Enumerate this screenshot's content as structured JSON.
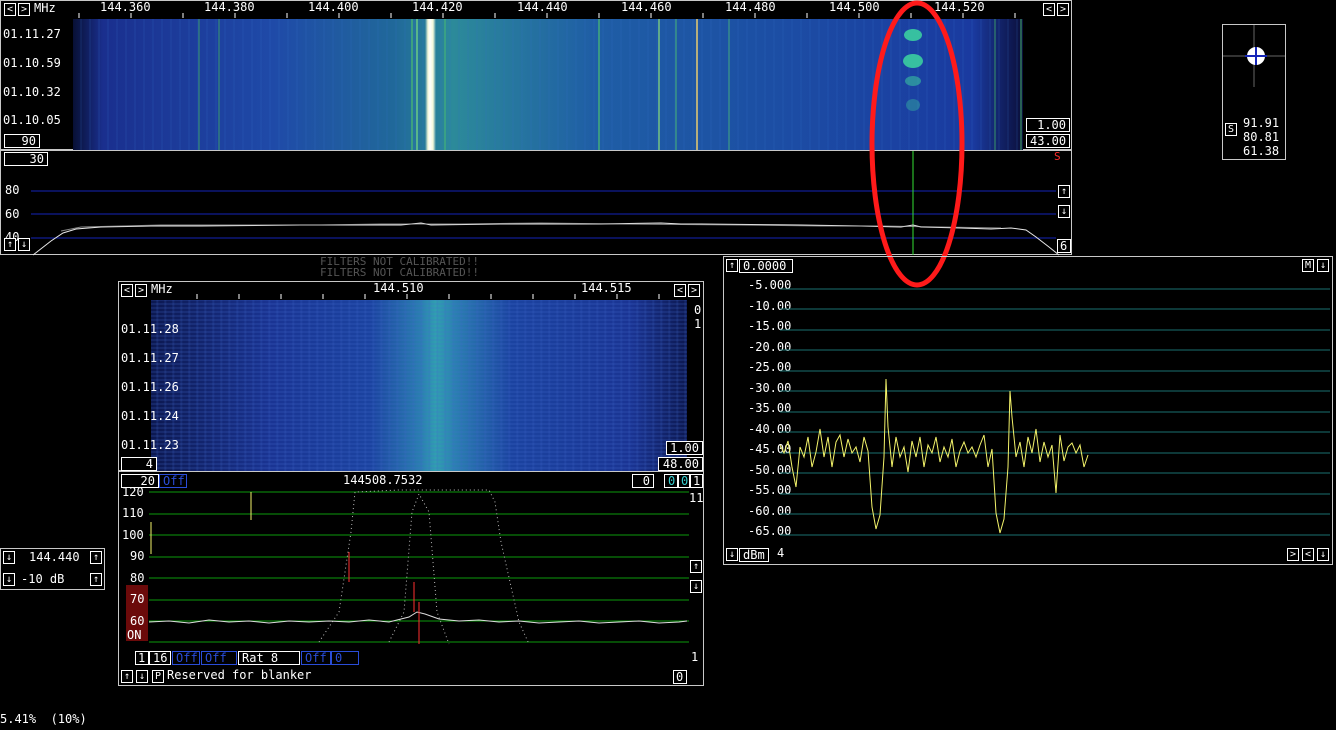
{
  "main_waterfall": {
    "unit": "MHz",
    "freq_ticks": [
      "144.360",
      "144.380",
      "144.400",
      "144.420",
      "144.440",
      "144.460",
      "144.480",
      "144.500",
      "144.520"
    ],
    "times": [
      "01.11.27",
      "01.10.59",
      "01.10.32",
      "01.10.05"
    ],
    "gain_box": "1.00",
    "zero_box": "43.00",
    "avg_box": "90"
  },
  "main_spectrum": {
    "range_box": "30",
    "s_label": "S",
    "y_ticks": [
      "80",
      "60",
      "40"
    ],
    "right_box": "6"
  },
  "warning": [
    "FILTERS NOT CALIBRATED!!",
    "FILTERS NOT CALIBRATED!!"
  ],
  "fft2": {
    "unit": "MHz",
    "freq_ticks": [
      "144.510",
      "144.515"
    ],
    "times": [
      "01.11.28",
      "01.11.27",
      "01.11.26",
      "01.11.24",
      "01.11.23"
    ],
    "right_top": [
      "0",
      "1"
    ],
    "gain_box": "1.00",
    "zero_box": "48.00",
    "avg_box": "4"
  },
  "baseband": {
    "range_box": "20",
    "off_label": "Off",
    "frequency": "144508.7532",
    "box_a": "0",
    "box_b": "0",
    "box_c": "0",
    "box_d": "1",
    "right_label": "11",
    "y_ticks": [
      "120",
      "110",
      "100",
      "90",
      "80",
      "70",
      "60"
    ],
    "on_label": "ON",
    "bottom_right": "1",
    "controls": {
      "b1": "1",
      "b2": "16",
      "off1": "Off",
      "off2": "Off",
      "rat": "Rat  8",
      "off3": "Off",
      "blank": "0"
    },
    "status_text": "Reserved for blanker",
    "status_right": "0",
    "p_label": "P"
  },
  "side_freq": {
    "value": "144.440",
    "gain": "-10 dB"
  },
  "smeter": {
    "s_label": "S",
    "values": [
      "91.91",
      "80.81",
      "61.38"
    ]
  },
  "level_graph": {
    "top_box": "0.0000",
    "m_label": "M",
    "y_ticks": [
      "-5.000",
      "-10.00",
      "-15.00",
      "-20.00",
      "-25.00",
      "-30.00",
      "-35.00",
      "-40.00",
      "-45.00",
      "-50.00",
      "-55.00",
      "-60.00",
      "-65.00"
    ],
    "unit": "dBm",
    "unit_num": "4"
  },
  "cpu_load": "5.41%  (10%)",
  "colors": {
    "trace": "#f3f36a",
    "grid_green": "#0c9a0c",
    "grid_blue": "#1525b8",
    "annotation": "#ff1a1a"
  }
}
